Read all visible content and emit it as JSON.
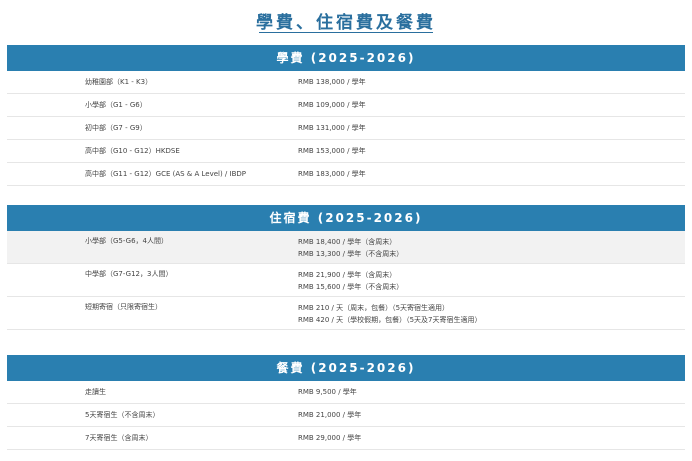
{
  "page_title": "學費、住宿費及餐費",
  "sections": [
    {
      "header": "學費 (2025-2026)",
      "rows": [
        {
          "label": "幼稚園部（K1 - K3）",
          "value": "RMB 138,000 / 學年"
        },
        {
          "label": "小學部（G1 - G6）",
          "value": "RMB 109,000 / 學年"
        },
        {
          "label": "初中部（G7 - G9）",
          "value": "RMB 131,000 / 學年"
        },
        {
          "label": "高中部（G10 - G12）HKDSE",
          "value": "RMB 153,000 / 學年"
        },
        {
          "label": "高中部（G11 - G12）GCE (AS & A Level) / IBDP",
          "value": "RMB 183,000 / 學年"
        }
      ]
    },
    {
      "header": "住宿費 (2025-2026)",
      "rows": [
        {
          "label": "小學部（G5-G6，4人間）",
          "value1": "RMB 18,400 / 學年（含周末）",
          "value2": "RMB 13,300 / 學年（不含周末）"
        },
        {
          "label": "中學部（G7-G12，3人間）",
          "value1": "RMB 21,900 / 學年（含周末）",
          "value2": "RMB 15,600 / 學年（不含周末）"
        },
        {
          "label": "短期寄宿（只限寄宿生）",
          "value1": "RMB 210 / 天（周末，包餐）（5天寄宿生適用）",
          "value2": "RMB 420 / 天（學校假期，包餐）（5天及7天寄宿生適用）"
        }
      ]
    },
    {
      "header": "餐費 (2025-2026)",
      "rows": [
        {
          "label": "走讀生",
          "value": "RMB 9,500 / 學年"
        },
        {
          "label": "5天寄宿生（不含周末）",
          "value": "RMB 21,000 / 學年"
        },
        {
          "label": "7天寄宿生（含周末）",
          "value": "RMB 29,000 / 學年"
        }
      ]
    }
  ]
}
